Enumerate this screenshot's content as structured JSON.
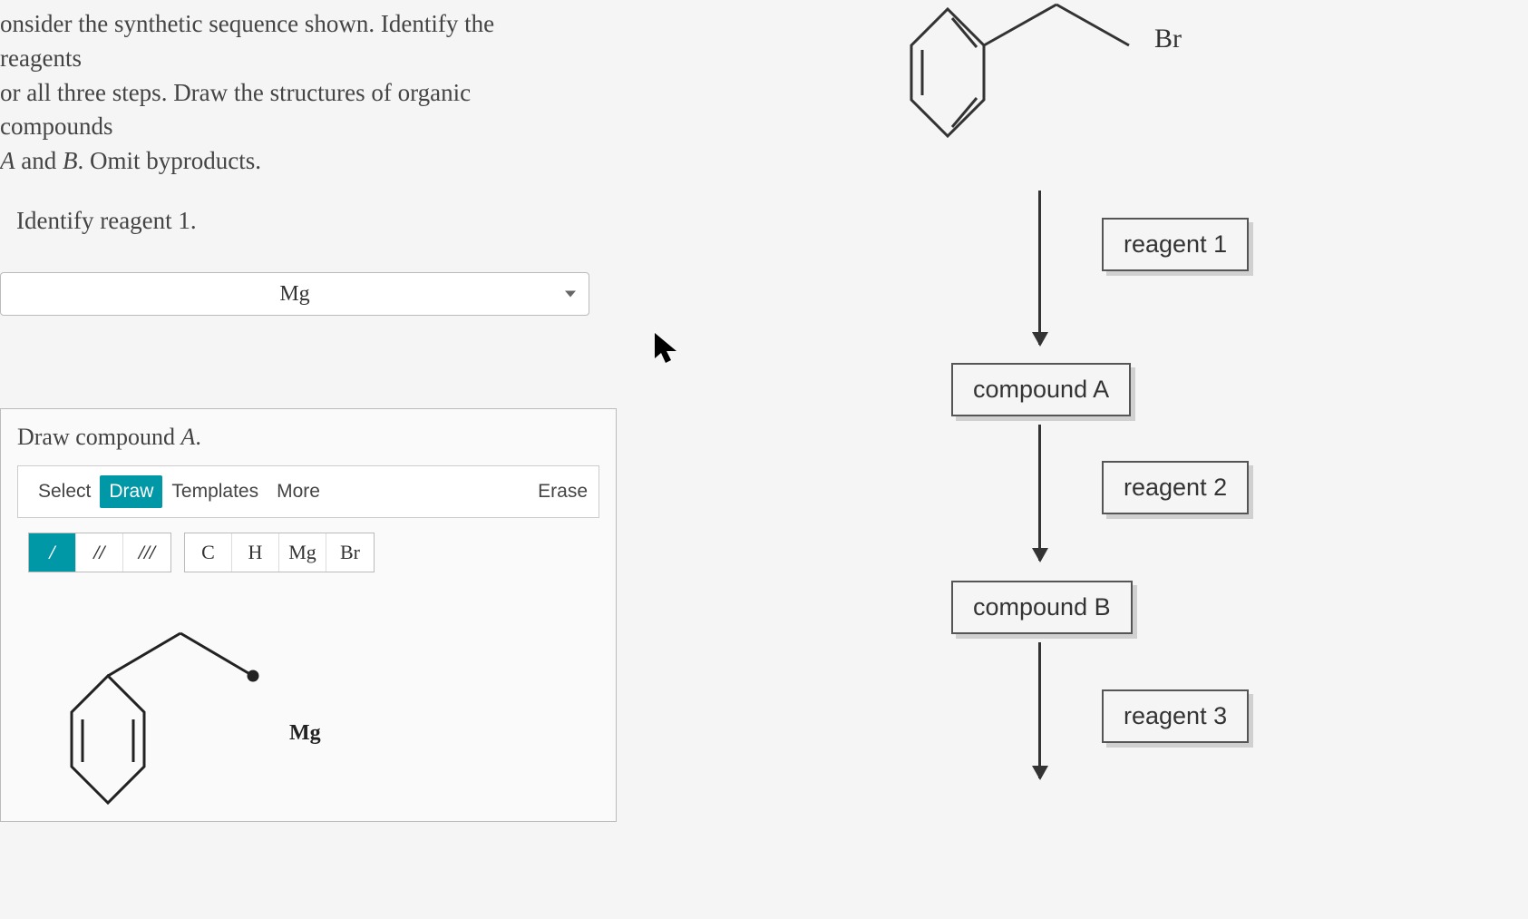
{
  "question": {
    "line1": "onsider the synthetic sequence shown. Identify the reagents",
    "line2": "or all three steps. Draw the structures of organic compounds",
    "line3": " and B. Omit byproducts."
  },
  "identifyLabel": "Identify reagent 1.",
  "reagent1Selected": "Mg",
  "drawPanel": {
    "title": "Draw compound A.",
    "tabs": {
      "select": "Select",
      "draw": "Draw",
      "templates": "Templates",
      "more": "More",
      "erase": "Erase"
    },
    "bonds": {
      "single": "/",
      "double": "//",
      "triple": "///"
    },
    "elements": {
      "c": "C",
      "h": "H",
      "mg": "Mg",
      "br": "Br"
    },
    "canvasLabel": "Mg"
  },
  "scheme": {
    "startLabel": "Br",
    "reagent1": "reagent 1",
    "compoundA": "compound A",
    "reagent2": "reagent 2",
    "compoundB": "compound B",
    "reagent3": "reagent 3"
  }
}
